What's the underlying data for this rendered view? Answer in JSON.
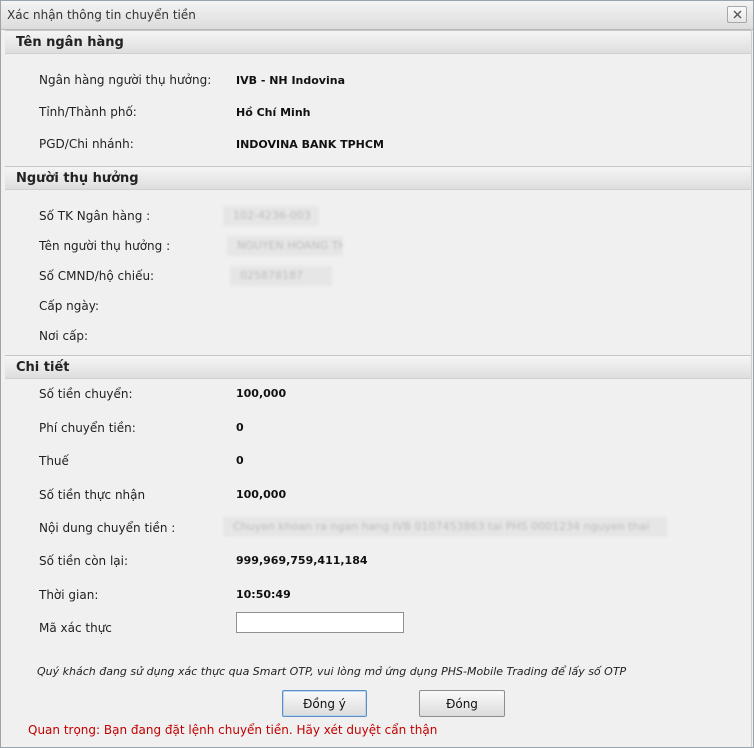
{
  "window": {
    "title": "Xác nhận thông tin chuyển tiền"
  },
  "bank_section": {
    "header": "Tên ngân hàng",
    "rows": [
      {
        "label": "Ngân hàng người thụ hưởng:",
        "value": "IVB - NH Indovina"
      },
      {
        "label": "Tỉnh/Thành phố:",
        "value": "Hồ Chí Minh"
      },
      {
        "label": "PGD/Chi nhánh:",
        "value": "INDOVINA BANK TPHCM"
      }
    ]
  },
  "beneficiary_section": {
    "header": "Người thụ hưởng",
    "rows": [
      {
        "label": "Số TK Ngân hàng :",
        "value": "102-4236-003"
      },
      {
        "label": "Tên người thụ hưởng :",
        "value": "NGUYEN HOANG THAI"
      },
      {
        "label": "Số CMND/hộ chiếu:",
        "value": "025878187"
      },
      {
        "label": "Cấp ngày:",
        "value": ""
      },
      {
        "label": "Nơi cấp:",
        "value": ""
      }
    ]
  },
  "detail_section": {
    "header": "Chi tiết",
    "rows": [
      {
        "label": "Số tiền chuyển:",
        "value": "100,000"
      },
      {
        "label": "Phí chuyển tiền:",
        "value": "0"
      },
      {
        "label": "Thuế",
        "value": "0"
      },
      {
        "label": "Số tiền thực nhận",
        "value": "100,000"
      },
      {
        "label": "Nội dung chuyển tiền :",
        "value": "Chuyen khoan ra ngan hang IVB 0107453863 tai PHS 0001234 nguyen thai"
      },
      {
        "label": "Số tiền còn lại:",
        "value": "999,969,759,411,184"
      },
      {
        "label": "Thời gian:",
        "value": "10:50:49"
      },
      {
        "label": "Mã xác thực",
        "value": ""
      }
    ]
  },
  "otp_hint": "Quý khách đang sử dụng xác thực qua Smart OTP, vui lòng mở ứng dụng PHS-Mobile Trading để lấy số OTP",
  "buttons": {
    "agree": "Đồng ý",
    "close": "Đóng"
  },
  "warning": "Quan trọng: Bạn đang đặt lệnh chuyển tiền. Hãy xét duyệt cẩn thận",
  "colors": {
    "warning": "#c20000",
    "header_bg": "#dedede"
  }
}
